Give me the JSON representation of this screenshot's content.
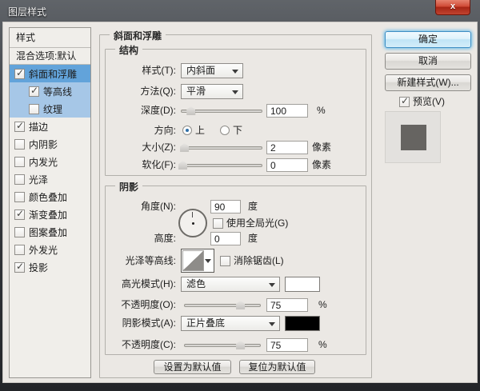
{
  "window": {
    "title": "图层样式",
    "close_glyph": "x"
  },
  "styles_panel": {
    "header": "样式",
    "blending_row": "混合选项:默认",
    "items": [
      {
        "label": "斜面和浮雕",
        "checked": true,
        "selected": true,
        "indent": false
      },
      {
        "label": "等高线",
        "checked": true,
        "highlight": true,
        "indent": true
      },
      {
        "label": "纹理",
        "checked": false,
        "highlight": true,
        "indent": true
      },
      {
        "label": "描边",
        "checked": true,
        "indent": false
      },
      {
        "label": "内阴影",
        "checked": false,
        "indent": false
      },
      {
        "label": "内发光",
        "checked": false,
        "indent": false
      },
      {
        "label": "光泽",
        "checked": false,
        "indent": false
      },
      {
        "label": "颜色叠加",
        "checked": false,
        "indent": false
      },
      {
        "label": "渐变叠加",
        "checked": true,
        "indent": false
      },
      {
        "label": "图案叠加",
        "checked": false,
        "indent": false
      },
      {
        "label": "外发光",
        "checked": false,
        "indent": false
      },
      {
        "label": "投影",
        "checked": true,
        "indent": false
      }
    ]
  },
  "panel": {
    "title": "斜面和浮雕",
    "structure": {
      "title": "结构",
      "style_label": "样式(T):",
      "style_value": "内斜面",
      "technique_label": "方法(Q):",
      "technique_value": "平滑",
      "depth_label": "深度(D):",
      "depth_value": "100",
      "depth_unit": "%",
      "depth_thumb_pct": 12,
      "direction_label": "方向:",
      "direction_up": "上",
      "direction_down": "下",
      "direction_selected": "上",
      "size_label": "大小(Z):",
      "size_value": "2",
      "size_unit": "像素",
      "size_thumb_pct": 4,
      "soften_label": "软化(F):",
      "soften_value": "0",
      "soften_unit": "像素",
      "soften_thumb_pct": 2
    },
    "shading": {
      "title": "阴影",
      "angle_label": "角度(N):",
      "angle_value": "90",
      "angle_unit": "度",
      "angle_degrees": 90,
      "global_light_label": "使用全局光(G)",
      "global_light_checked": false,
      "altitude_label": "高度:",
      "altitude_value": "0",
      "altitude_unit": "度",
      "gloss_contour_label": "光泽等高线:",
      "antialias_label": "消除锯齿(L)",
      "antialias_checked": false,
      "highlight_mode_label": "高光模式(H):",
      "highlight_mode_value": "滤色",
      "highlight_color": "#ffffff",
      "highlight_opacity_label": "不透明度(O):",
      "highlight_opacity_value": "75",
      "highlight_opacity_unit": "%",
      "highlight_opacity_thumb_pct": 73,
      "shadow_mode_label": "阴影模式(A):",
      "shadow_mode_value": "正片叠底",
      "shadow_color": "#000000",
      "shadow_opacity_label": "不透明度(C):",
      "shadow_opacity_value": "75",
      "shadow_opacity_unit": "%",
      "shadow_opacity_thumb_pct": 73
    },
    "make_default_label": "设置为默认值",
    "reset_default_label": "复位为默认值"
  },
  "actions": {
    "ok": "确定",
    "cancel": "取消",
    "new_style": "新建样式(W)...",
    "preview": "预览(V)",
    "preview_checked": true
  },
  "colors": {
    "selected_row": "#62a3da",
    "highlight_row": "#a6c7e7",
    "dialog_bg": "#ebe8e4",
    "titlebar_dark": "#232529",
    "close_red": "#a62514",
    "default_button_glow": "#66bbe8",
    "preview_inner_gray": "#666461"
  }
}
